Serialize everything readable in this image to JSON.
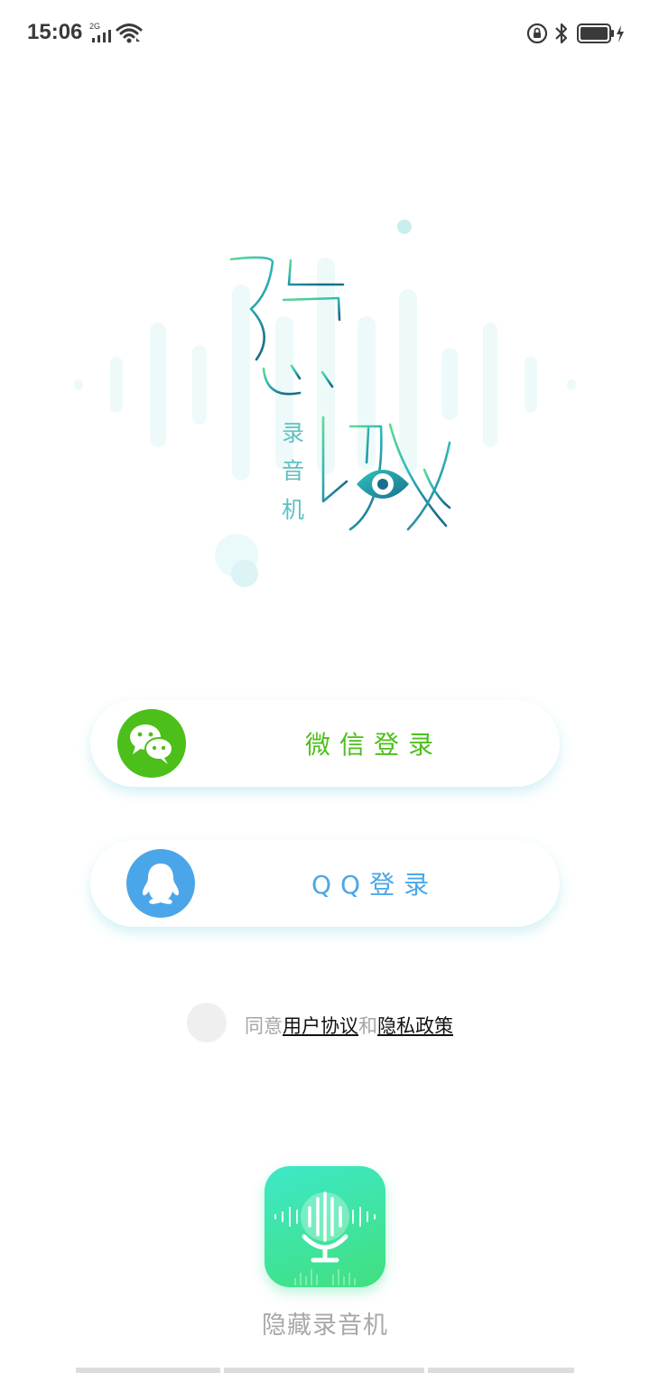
{
  "status_bar": {
    "time": "15:06",
    "network": "2G"
  },
  "logo": {
    "title_char_1": "隐",
    "title_char_2": "藏",
    "subtitle_chars": [
      "录",
      "音",
      "机"
    ],
    "gradient_start": "#5fdc8f",
    "gradient_end": "#1a6f8c"
  },
  "login": {
    "wechat_label": "微信登录",
    "qq_label": "QQ登录",
    "wechat_color": "#4cbf1a",
    "qq_color": "#4ba6e9"
  },
  "agreement": {
    "prefix": "同意",
    "user_agreement": "用户协议",
    "conjunction": "和",
    "privacy_policy": "隐私政策"
  },
  "app": {
    "name": "隐藏录音机"
  }
}
